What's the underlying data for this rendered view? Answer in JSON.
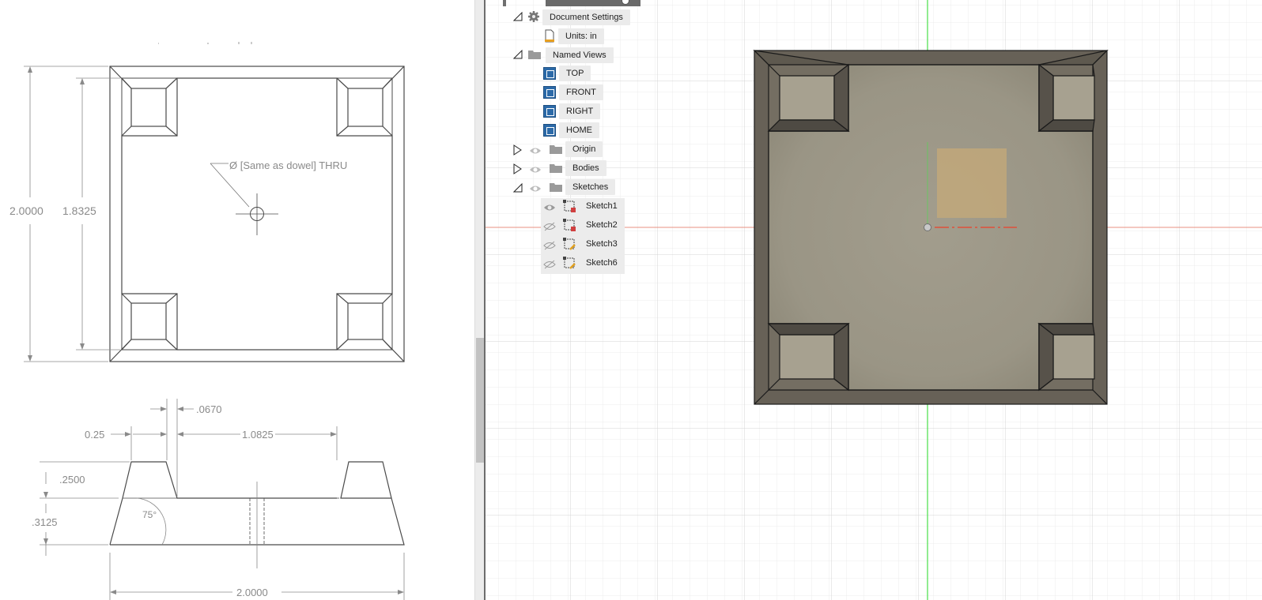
{
  "drawing": {
    "top_view": {
      "overall_width_dim": "2.0000",
      "inner_height_dim": "1.8325",
      "hole_note": "Ø [Same as dowel] THRU"
    },
    "side_view": {
      "offset_dim": ".0670",
      "lip_dim": "0.25",
      "inner_span_dim": "1.0825",
      "post_height_dim": ".2500",
      "base_height_dim": ".3125",
      "angle_dim": "75°",
      "base_width_dim": "2.0000"
    }
  },
  "browser": {
    "document_settings": "Document Settings",
    "units": "Units: in",
    "named_views": "Named Views",
    "views": [
      "TOP",
      "FRONT",
      "RIGHT",
      "HOME"
    ],
    "origin": "Origin",
    "bodies": "Bodies",
    "sketches": "Sketches",
    "sketch_items": [
      "Sketch1",
      "Sketch2",
      "Sketch3",
      "Sketch6"
    ]
  },
  "colors": {
    "model_frame": "#676157",
    "model_face": "#9d9888",
    "sketch_fill": "#c6a978",
    "x_axis": "#e89080",
    "y_axis": "#48e048",
    "view_icon": "#2c6aa8"
  },
  "icons": {
    "settings": "gear-icon",
    "units": "document-icon",
    "folder": "folder-icon",
    "visibility": "eye-icon",
    "sketch": "sketch-icon",
    "view": "named-view-icon"
  }
}
